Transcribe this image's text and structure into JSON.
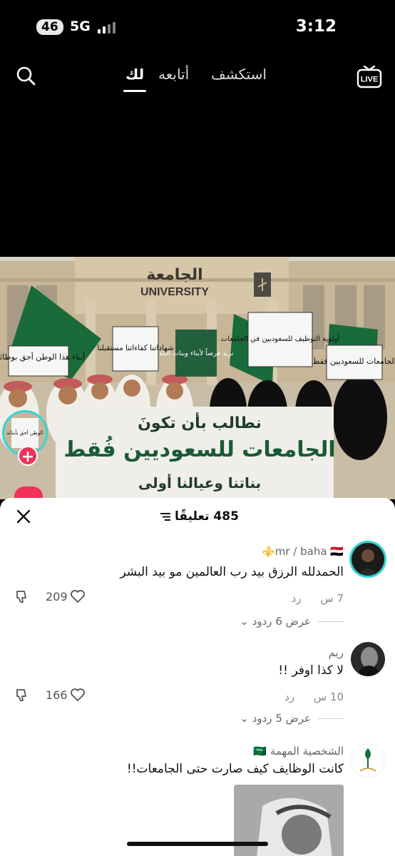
{
  "status_bar": {
    "signal_badge": "46",
    "network": "5G",
    "time": "3:12"
  },
  "top_nav": {
    "tabs": [
      {
        "label": "استكشف",
        "active": false
      },
      {
        "label": "أتابعه",
        "active": false
      },
      {
        "label": "لك",
        "active": true
      }
    ],
    "live_label": "LIVE"
  },
  "video": {
    "building_label_ar": "الجامعة",
    "building_label_en": "UNIVERSITY",
    "signs": {
      "left": "أبناء هذا الوطن أحق بوظائفه",
      "certificates": "شهاداتنا كفاءاتنا مستقبلنا",
      "opportunities": "نريد فرصاً لأبناء وبنات البلد",
      "priority": "أولوية التوظيف للسعوديين في الجامعات",
      "universities": "الجامعات للسعوديين فقط"
    },
    "banner": {
      "line1": "نطالب بأن تكونَ",
      "line2": "الجامعات للسعوديين فُقط",
      "line3": "بناتنا وعيالنا أولى"
    },
    "avatar_sign": "الوطن أحق بأبنائه"
  },
  "comments_sheet": {
    "count": "485",
    "count_label": "تعليقًا",
    "comments": [
      {
        "user": "mr / baha",
        "flags": "🇾🇪⚜️",
        "text": "الحمدلله الرزق بيد رب العالمين مو بيد البشر",
        "age": "7 س",
        "reply": "رد",
        "replies": "عرض 6 ردود",
        "likes": "209"
      },
      {
        "user": "ريم",
        "flags": "",
        "text": "لا كذا اوفر !!",
        "age": "10 س",
        "reply": "رد",
        "replies": "عرض 5 ردود",
        "likes": "166"
      },
      {
        "user": "الشخصية المهمة",
        "flags": "🇸🇦",
        "text": "كانت الوظايف كيف صارت حتى الجامعات!!"
      }
    ]
  },
  "colors": {
    "accent": "#f0315a",
    "ring": "#2fd5d0",
    "flag_green": "#1a6b3a"
  }
}
